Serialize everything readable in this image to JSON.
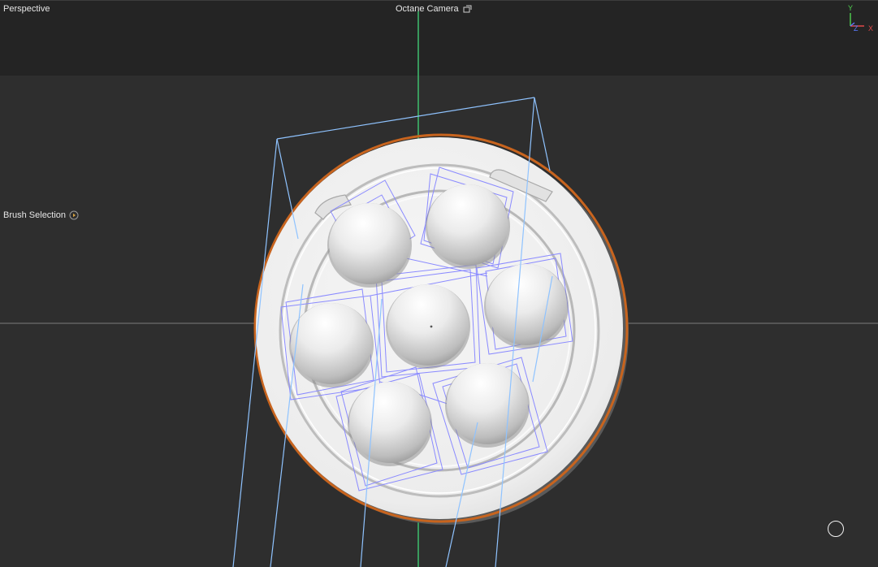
{
  "viewport": {
    "view_name": "Perspective",
    "camera_name": "Octane Camera",
    "active_tool": "Brush Selection"
  },
  "axis_gizmo": {
    "y_label": "Y",
    "z_label": "Z",
    "x_label": "X",
    "y_color": "#4fd24f",
    "z_color": "#5a7bff",
    "x_color": "#e04848"
  },
  "icons": {
    "camera_link": "camera-link-icon",
    "tool_options": "play-circle-icon",
    "cursor": "brush-cursor-icon"
  },
  "colors": {
    "background": "#2e2e2e",
    "safe_frame": "#242424",
    "grid_y_axis": "#3fbf6f",
    "object_highlight": "#c8641e",
    "wireframe": "#8a8aff",
    "camera_frustum": "#8fc3ff"
  }
}
